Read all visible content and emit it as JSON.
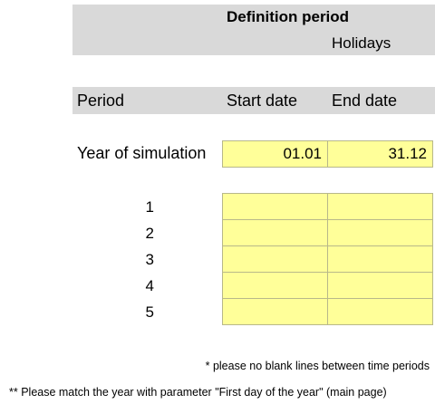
{
  "header": {
    "title": "Definition period",
    "subtitle": "Holidays"
  },
  "columns": {
    "period": "Period",
    "start_date": "Start date",
    "end_date": "End date"
  },
  "year_row": {
    "label": "Year of simulation",
    "start": "01.01",
    "end": "31.12"
  },
  "periods": [
    {
      "number": "1",
      "start": "",
      "end": ""
    },
    {
      "number": "2",
      "start": "",
      "end": ""
    },
    {
      "number": "3",
      "start": "",
      "end": ""
    },
    {
      "number": "4",
      "start": "",
      "end": ""
    },
    {
      "number": "5",
      "start": "",
      "end": ""
    }
  ],
  "notes": {
    "note1": "* please no blank lines between time periods",
    "note2": "** Please match the year with parameter \"First day of the year\" (main page)"
  },
  "colors": {
    "band": "#d9d9d9",
    "input_cell": "#ffff99"
  }
}
